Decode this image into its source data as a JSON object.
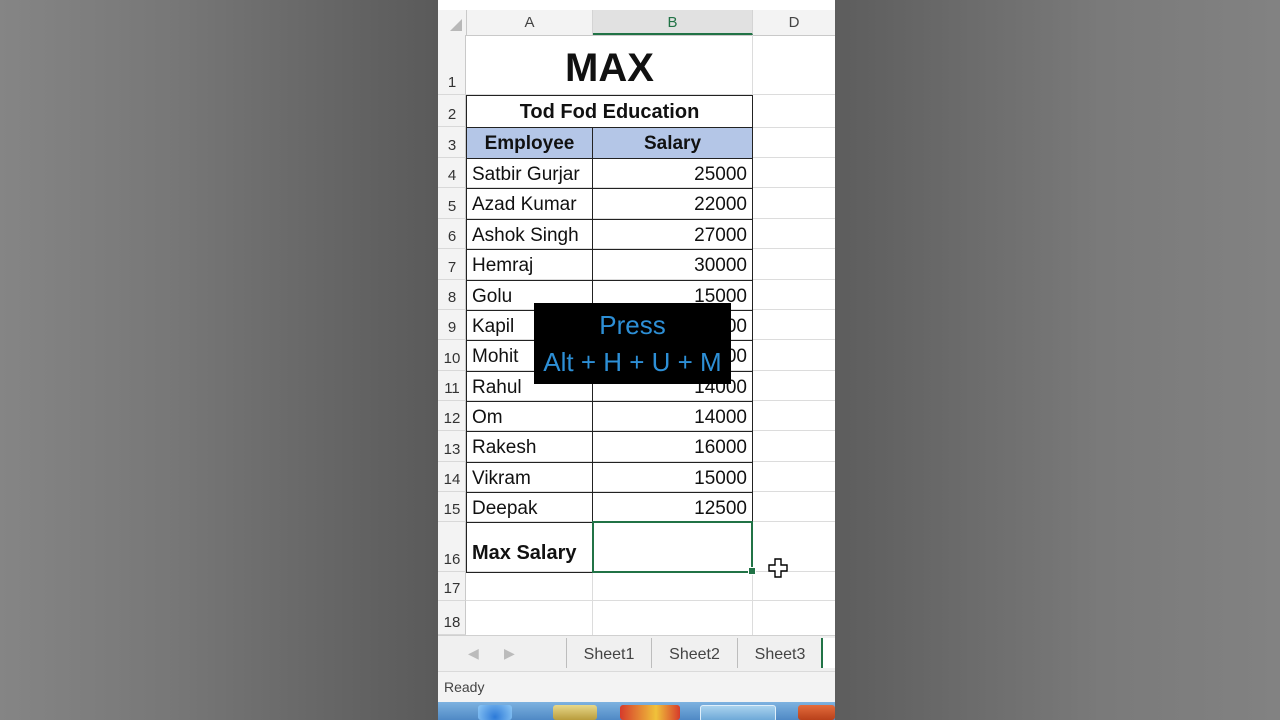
{
  "sheet": {
    "columns": [
      "A",
      "B",
      "D"
    ],
    "rows": [
      "1",
      "2",
      "3",
      "4",
      "5",
      "6",
      "7",
      "8",
      "9",
      "10",
      "11",
      "12",
      "13",
      "14",
      "15",
      "16",
      "17",
      "18"
    ],
    "title": "MAX",
    "subtitle": "Tod Fod Education",
    "headers": {
      "employee": "Employee",
      "salary": "Salary"
    },
    "data": [
      {
        "name": "Satbir Gurjar",
        "salary": "25000"
      },
      {
        "name": "Azad Kumar",
        "salary": "22000"
      },
      {
        "name": "Ashok Singh",
        "salary": "27000"
      },
      {
        "name": "Hemraj",
        "salary": "30000"
      },
      {
        "name": "Golu",
        "salary": "15000"
      },
      {
        "name": "Kapil",
        "salary": "00"
      },
      {
        "name": "Mohit",
        "salary": "00"
      },
      {
        "name": "Rahul",
        "salary": "14000"
      },
      {
        "name": "Om",
        "salary": "14000"
      },
      {
        "name": "Rakesh",
        "salary": "16000"
      },
      {
        "name": "Vikram",
        "salary": "15000"
      },
      {
        "name": "Deepak",
        "salary": "12500"
      }
    ],
    "max_label": "Max Salary",
    "max_value": ""
  },
  "overlay": {
    "line1": "Press",
    "line2": "Alt + H + U + M"
  },
  "tabs": [
    "Sheet1",
    "Sheet2",
    "Sheet3"
  ],
  "status": "Ready",
  "colors": {
    "header_fill": "#b4c6e7",
    "accent": "#217346",
    "overlay_text": "#2d8fd6"
  },
  "icons": [
    "select-all-icon",
    "tab-prev-icon",
    "tab-next-icon",
    "cell-cursor-icon"
  ]
}
